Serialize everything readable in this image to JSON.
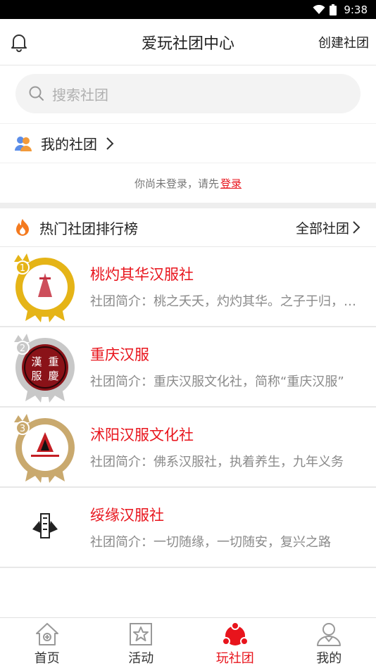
{
  "status": {
    "time": "9:38"
  },
  "header": {
    "title": "爱玩社团中心",
    "create_label": "创建社团"
  },
  "search": {
    "placeholder": "搜索社团"
  },
  "mine": {
    "label": "我的社团"
  },
  "login_tip": {
    "text": "你尚未登录，请先",
    "link": "登录"
  },
  "hot": {
    "title": "热门社团排行榜",
    "all_label": "全部社团"
  },
  "clubs": [
    {
      "rank": "1",
      "name": "桃灼其华汉服社",
      "desc": "社团简介：桃之夭夭，灼灼其华。之子于归，宜其室家"
    },
    {
      "rank": "2",
      "name": "重庆汉服",
      "desc": "社团简介：重庆汉服文化社，简称“重庆汉服”"
    },
    {
      "rank": "3",
      "name": "沭阳汉服文化社",
      "desc": "社团简介：佛系汉服社，执着养生，九年义务"
    },
    {
      "rank": "",
      "name": "绥缘汉服社",
      "desc": "社团简介：一切随缘，一切随安，复兴之路"
    }
  ],
  "tabs": [
    {
      "label": "首页"
    },
    {
      "label": "活动"
    },
    {
      "label": "玩社团"
    },
    {
      "label": "我的"
    }
  ],
  "colors": {
    "accent": "#e8141c",
    "gold": "#e5b417",
    "silver": "#c8c8c8",
    "bronze": "#c9a96e"
  },
  "icons": [
    "bell-icon",
    "search-icon",
    "people-icon",
    "fire-icon",
    "chevron-right-icon",
    "home-icon",
    "star-icon",
    "club-icon",
    "user-icon",
    "wifi-icon",
    "battery-icon"
  ]
}
